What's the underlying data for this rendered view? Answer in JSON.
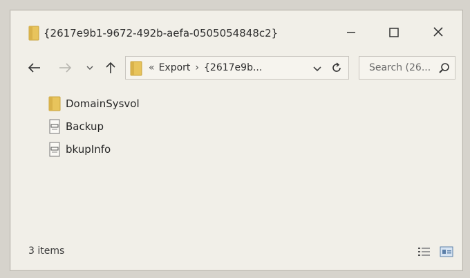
{
  "window": {
    "title": "{2617e9b1-9672-492b-aefa-0505054848c2}",
    "title_icon": "folder-icon",
    "controls": {
      "minimize": "minimize-icon",
      "maximize": "maximize-icon",
      "close": "close-icon"
    }
  },
  "nav": {
    "back": "back-arrow-icon",
    "forward": "forward-arrow-icon",
    "recent": "chevron-down-icon",
    "up": "up-arrow-icon"
  },
  "address": {
    "overflow": "«",
    "crumbs": [
      "Export",
      "{2617e9b..."
    ],
    "separator": "›"
  },
  "search": {
    "placeholder": "Search (26..."
  },
  "files": [
    {
      "name": "DomainSysvol",
      "icon": "folder-icon"
    },
    {
      "name": "Backup",
      "icon": "file-icon"
    },
    {
      "name": "bkupInfo",
      "icon": "file-icon"
    }
  ],
  "status": {
    "count": "3 items"
  },
  "colors": {
    "window_bg": "#f1efe8",
    "folder": "#e8c45c",
    "text": "#2e2e2e"
  }
}
